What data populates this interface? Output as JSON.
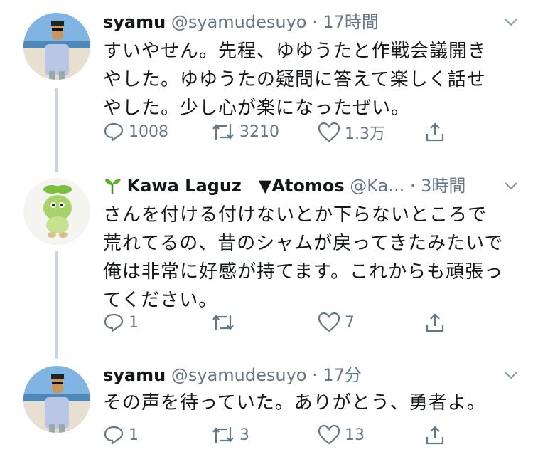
{
  "tweets": [
    {
      "name": "syamu",
      "handle": "@syamudesuyo",
      "time": "17時間",
      "text": "すいやせん。先程、ゆゆうたと作戦会議開きやした。ゆゆうたの疑問に答えて楽しく話せやした。少し心が楽になったぜい。",
      "replies": "1008",
      "retweets": "3210",
      "likes": "1.3万"
    },
    {
      "name": "Kawa Laguz　▼Atomos",
      "handle": "@Ka...",
      "time": "3時間",
      "text": "さんを付ける付けないとか下らないところで荒れてるの、昔のシャムが戻ってきたみたいで俺は非常に好感が持てます。これからも頑張ってください。",
      "replies": "1",
      "retweets": "",
      "likes": "7"
    },
    {
      "name": "syamu",
      "handle": "@syamudesuyo",
      "time": "17分",
      "text": "その声を待っていた。ありがとう、勇者よ。",
      "replies": "1",
      "retweets": "3",
      "likes": "13"
    }
  ],
  "separator": "·",
  "icons": {
    "reply": "reply-icon",
    "retweet": "retweet-icon",
    "like": "heart-icon",
    "share": "share-icon",
    "caret": "chevron-down-icon",
    "sprout": "sprout-emoji-icon"
  },
  "colors": {
    "icon_gray": "#657786",
    "thread_line": "#ccd6dd",
    "name": "#14171a"
  }
}
